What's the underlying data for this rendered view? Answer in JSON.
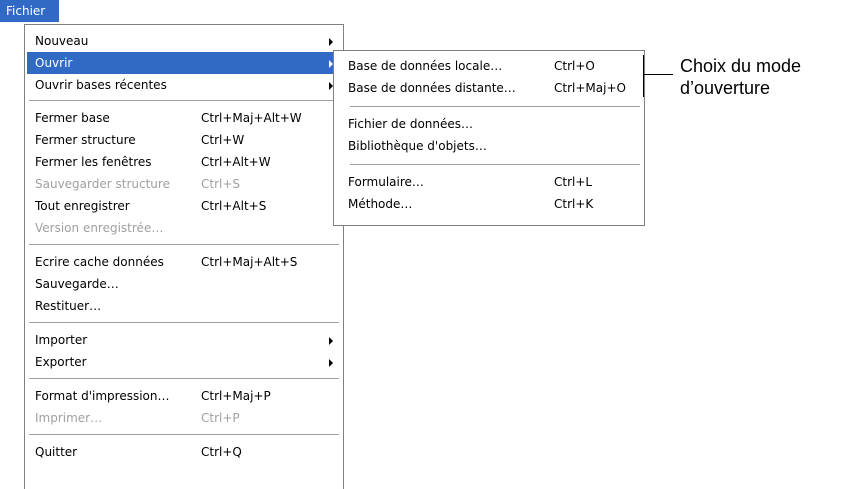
{
  "menubar": {
    "title": "Fichier"
  },
  "menu": {
    "items": [
      {
        "label": "Nouveau",
        "shortcut": "",
        "submenu": true
      },
      {
        "label": "Ouvrir",
        "shortcut": "",
        "submenu": true,
        "highlighted": true
      },
      {
        "label": "Ouvrir bases récentes",
        "shortcut": "",
        "submenu": true
      },
      {
        "label": "Fermer base",
        "shortcut": "Ctrl+Maj+Alt+W"
      },
      {
        "label": "Fermer structure",
        "shortcut": "Ctrl+W"
      },
      {
        "label": "Fermer les fenêtres",
        "shortcut": "Ctrl+Alt+W"
      },
      {
        "label": "Sauvegarder structure",
        "shortcut": "Ctrl+S",
        "disabled": true
      },
      {
        "label": "Tout enregistrer",
        "shortcut": "Ctrl+Alt+S"
      },
      {
        "label": "Version enregistrée…",
        "shortcut": "",
        "disabled": true
      },
      {
        "label": "Ecrire cache données",
        "shortcut": "Ctrl+Maj+Alt+S"
      },
      {
        "label": "Sauvegarde…",
        "shortcut": ""
      },
      {
        "label": "Restituer…",
        "shortcut": ""
      },
      {
        "label": "Importer",
        "shortcut": "",
        "submenu": true
      },
      {
        "label": "Exporter",
        "shortcut": "",
        "submenu": true
      },
      {
        "label": "Format d'impression…",
        "shortcut": "Ctrl+Maj+P"
      },
      {
        "label": "Imprimer…",
        "shortcut": "Ctrl+P",
        "disabled": true
      },
      {
        "label": "Quitter",
        "shortcut": "Ctrl+Q"
      }
    ]
  },
  "submenu": {
    "items": [
      {
        "label": "Base de données locale…",
        "shortcut": "Ctrl+O"
      },
      {
        "label": "Base de données distante…",
        "shortcut": "Ctrl+Maj+O"
      },
      {
        "label": "Fichier de données…",
        "shortcut": ""
      },
      {
        "label": "Bibliothèque d'objets…",
        "shortcut": ""
      },
      {
        "label": "Formulaire…",
        "shortcut": "Ctrl+L"
      },
      {
        "label": "Méthode…",
        "shortcut": "Ctrl+K"
      }
    ]
  },
  "callout": {
    "line1": "Choix du mode",
    "line2": "d’ouverture"
  },
  "colors": {
    "highlight": "#316ac5",
    "disabled": "#a0a0a0",
    "separator": "#a0a0a0"
  }
}
